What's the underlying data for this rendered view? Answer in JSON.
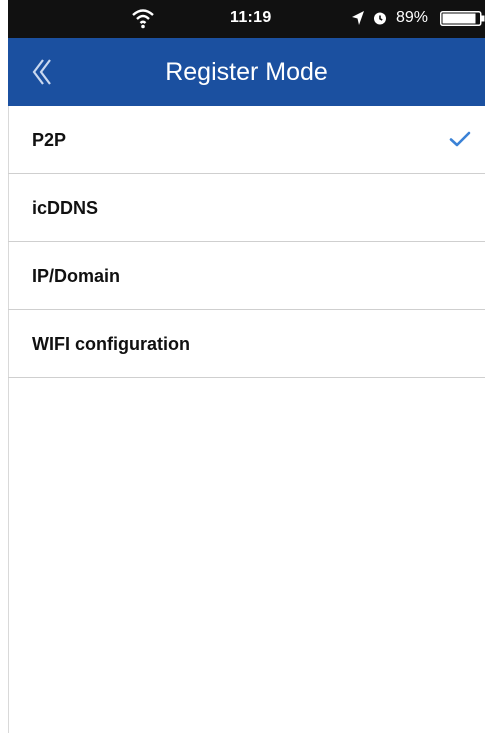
{
  "status_bar": {
    "time": "11:19",
    "battery": "89%"
  },
  "nav": {
    "title": "Register Mode",
    "back_icon": "back-chevron-icon"
  },
  "options": [
    {
      "label": "P2P",
      "selected": true
    },
    {
      "label": "icDDNS",
      "selected": false
    },
    {
      "label": "IP/Domain",
      "selected": false
    },
    {
      "label": "WIFI configuration",
      "selected": false
    }
  ],
  "colors": {
    "nav_background": "#1b50a0",
    "status_background": "#111111",
    "checkmark": "#3b82d6"
  }
}
